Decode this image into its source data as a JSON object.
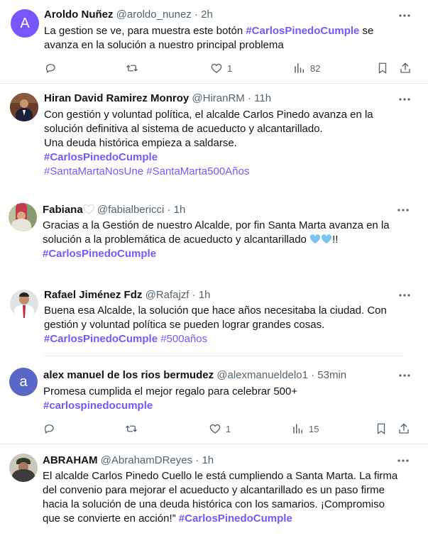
{
  "tweets": [
    {
      "name": "Aroldo Nuñez",
      "handle": "@aroldo_nunez",
      "sep": "·",
      "time": "2h",
      "avatar_letter": "A",
      "text1": "La gestion se ve, para muestra este  botón ",
      "tag1": "#CarlosPinedoCumple",
      "text1b": " se",
      "text2": "avanza en la solución a nuestro principal problema",
      "likes": "1",
      "views": "82"
    },
    {
      "name": "Hiran David Ramirez Monroy",
      "handle": "@HiranRM",
      "sep": "·",
      "time": "11h",
      "line1": "Con gestión y voluntad política, el alcalde Carlos Pinedo avanza en la",
      "line2": "solución definitiva al sistema de acueducto y alcantarillado.",
      "line3": "Una deuda histórica empieza a saldarse.",
      "tag1": "#CarlosPinedoCumple",
      "tag2": "#SantaMartaNosUne",
      "tag3": "#SantaMarta500Años"
    },
    {
      "name": "Fabiana",
      "handle": "@fabialbericci",
      "sep": "·",
      "time": "1h",
      "line1": "Gracias a la Gestión de nuestro Alcalde, por fin Santa Marta avanza en la",
      "line2": "solución a la problemática de acueducto y alcantarillado ",
      "line2end": "!!",
      "tag1": "#CarlosPinedoCumple"
    },
    {
      "name": "Rafael Jiménez Fdz",
      "handle": "@Rafajzf",
      "sep": "·",
      "time": "1h",
      "line1": "Buena esa Alcalde, la solución que hace años necesitaba la ciudad. Con",
      "line2": "gestión y voluntad política se pueden lograr grandes cosas.",
      "tag1": "#CarlosPinedoCumple",
      "tag2": "#500años"
    },
    {
      "name": "alex manuel de los rios bermudez",
      "handle": "@alexmanueldelo1",
      "sep": "·",
      "time": "53min",
      "avatar_letter": "a",
      "line1": "Promesa cumplida el mejor  regalo para  celebrar  500+",
      "tag1": "#carlospinedocumple",
      "likes": "1",
      "views": "15"
    },
    {
      "name": "ABRAHAM",
      "handle": "@AbrahamDReyes",
      "sep": "·",
      "time": "1h",
      "line1": "El alcalde Carlos Pinedo Cuello le está cumpliendo a Santa Marta. La firma",
      "line2": "del convenio para mejorar el acueducto y alcantarillado es un paso firme",
      "line3": "hacia la solución de una deuda histórica con los samarios. ¡Compromiso",
      "line4": "que se convierte en acción!” ",
      "tag1": "#CarlosPinedoCumple"
    }
  ],
  "colors": {
    "hashtag": "#7856ff",
    "secondary_text": "#536471",
    "avatar_purple": "#7856ff",
    "avatar_indigo": "#5b67c7",
    "blue_heart": "#7cc4f0"
  },
  "icons": [
    "more-icon",
    "reply-icon",
    "retweet-icon",
    "like-icon",
    "views-icon",
    "bookmark-icon",
    "share-icon",
    "white-heart-icon",
    "blue-heart-icon"
  ]
}
